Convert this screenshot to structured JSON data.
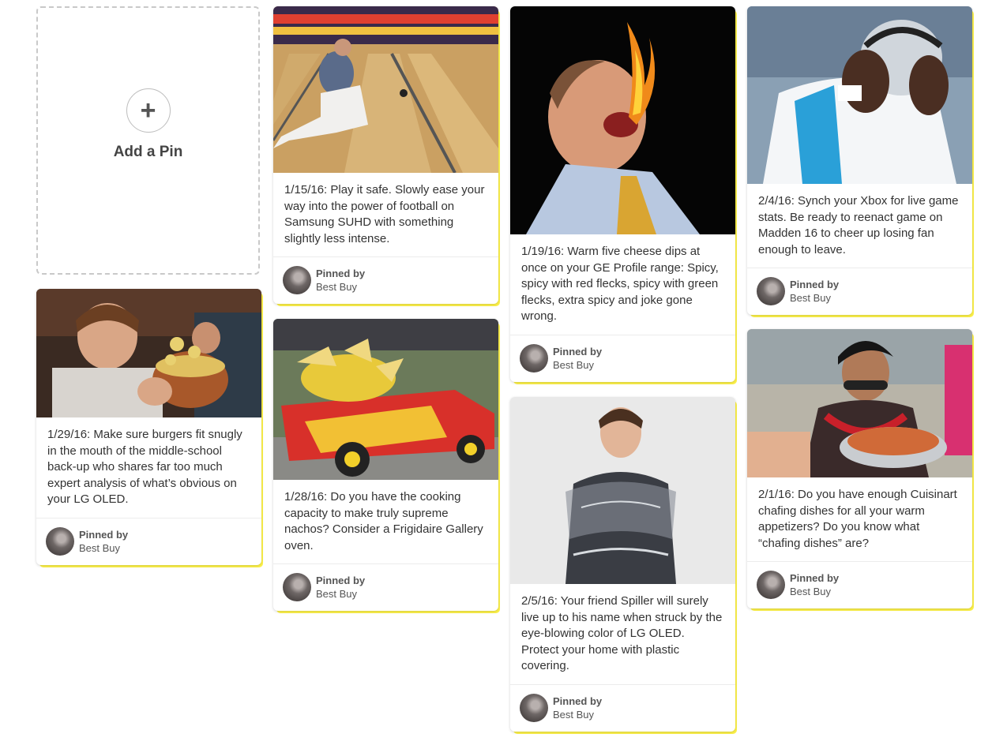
{
  "add_pin": {
    "icon": "plus-icon",
    "label": "Add a Pin",
    "plus_glyph": "+"
  },
  "pins": [
    {
      "id": "bowling",
      "description": "1/15/16: Play it safe. Slowly ease your way into the power of football on Samsung SUHD with something slightly less intense.",
      "pinned_by_label": "Pinned by",
      "pinner": "Best Buy"
    },
    {
      "id": "fire",
      "description": "1/19/16: Warm five cheese dips at once on your GE Profile range: Spicy, spicy with red flecks, spicy with green flecks, extra spicy and joke gone wrong.",
      "pinned_by_label": "Pinned by",
      "pinner": "Best Buy"
    },
    {
      "id": "football",
      "description": "2/4/16: Synch your Xbox for live game stats. Be ready to reenact game on Madden 16 to cheer up losing fan enough to leave.",
      "pinned_by_label": "Pinned by",
      "pinner": "Best Buy"
    },
    {
      "id": "burger",
      "description": "1/29/16: Make sure burgers fit snugly in the mouth of the middle-school back-up who shares far too much expert analysis of what’s obvious on your LG OLED.",
      "pinned_by_label": "Pinned by",
      "pinner": "Best Buy"
    },
    {
      "id": "nachos",
      "description": "1/28/16: Do you have the cooking capacity to make truly supreme nachos? Consider a Frigidaire Gallery oven.",
      "pinned_by_label": "Pinned by",
      "pinner": "Best Buy"
    },
    {
      "id": "plastic",
      "description": "2/5/16: Your friend Spiller will surely live up to his name when struck by the eye-blowing color of LG OLED. Protect your home with plastic covering.",
      "pinned_by_label": "Pinned by",
      "pinner": "Best Buy"
    },
    {
      "id": "chafing",
      "description": "2/1/16: Do you have enough Cuisinart chafing dishes for all your warm appetizers? Do you know what “chafing dishes” are?",
      "pinned_by_label": "Pinned by",
      "pinner": "Best Buy"
    }
  ],
  "colors": {
    "card_accent": "#fdf24a",
    "text": "#333333",
    "dashed_border": "#c9c9c9"
  }
}
